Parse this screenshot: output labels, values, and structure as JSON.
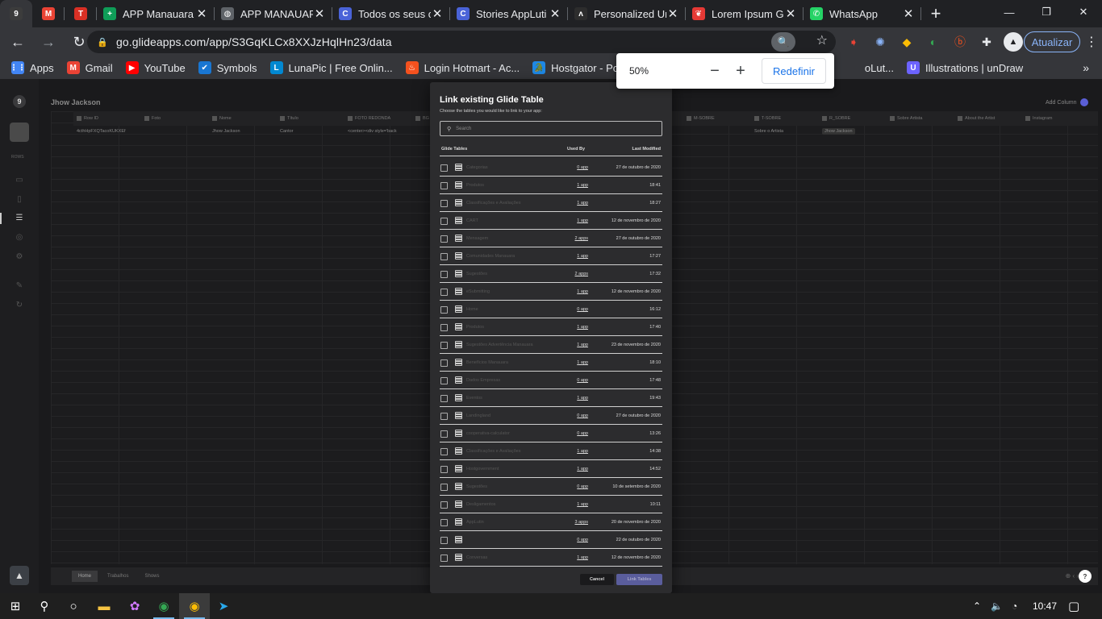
{
  "browser": {
    "tabs": [
      {
        "label": "",
        "icon": "9",
        "color": "#3c3c3c",
        "pinned": true,
        "active": true
      },
      {
        "label": "",
        "icon": "M",
        "color": "#ea4335",
        "pinned": true
      },
      {
        "label": "",
        "icon": "T",
        "color": "#d93025",
        "pinned": true
      },
      {
        "label": "APP Manauara",
        "icon": "+",
        "color": "#0f9d58"
      },
      {
        "label": "APP MANAUAR",
        "icon": "◍",
        "color": "#5f6368"
      },
      {
        "label": "Todos os seus c",
        "icon": "C",
        "color": "#4a63d8"
      },
      {
        "label": "Stories AppLuti",
        "icon": "C",
        "color": "#4a63d8"
      },
      {
        "label": "Personalized Ur",
        "icon": "ʌ",
        "color": "#2d2d2d"
      },
      {
        "label": "Lorem Ipsum G",
        "icon": "❦",
        "color": "#e53935"
      },
      {
        "label": "WhatsApp",
        "icon": "✆",
        "color": "#25d366"
      }
    ],
    "url": "go.glideapps.com/app/S3GqKLCx8XXJzHqlHn23/data",
    "update_label": "Atualizar",
    "bookmarks": [
      {
        "label": "Apps",
        "icon": "⋮⋮",
        "color": "#4285f4"
      },
      {
        "label": "Gmail",
        "icon": "M",
        "color": "#ea4335"
      },
      {
        "label": "YouTube",
        "icon": "▶",
        "color": "#ff0000"
      },
      {
        "label": "Symbols",
        "icon": "✔",
        "color": "#1976d2"
      },
      {
        "label": "LunaPic | Free Onlin...",
        "icon": "L",
        "color": "#0288d1"
      },
      {
        "label": "Login Hotmart - Ac...",
        "icon": "♨",
        "color": "#f4511e"
      },
      {
        "label": "Hostgator - Portal...",
        "icon": "🐊",
        "color": "#1e88e5"
      },
      {
        "label": "oLut...",
        "icon": "",
        "color": "#35363a"
      },
      {
        "label": "Illustrations | unDraw",
        "icon": "U",
        "color": "#6c63ff"
      }
    ]
  },
  "zoom": {
    "value": "50%",
    "minus": "−",
    "plus": "+",
    "reset": "Redefinir"
  },
  "app": {
    "left_rows_label": "ROWS",
    "sheet_title": "Jhow Jackson",
    "add_column": "Add Column",
    "columns": [
      "Row ID",
      "Foto",
      "Nome",
      "Título",
      "FOTO REDONDA",
      "BG",
      "",
      "",
      "",
      "M-SOBRE",
      "T-SOBRE",
      "R_SOBRE",
      "Sobre Artista",
      "About the Artist",
      "Instagram"
    ],
    "row": [
      "4cthHpFXQTacoKUKXEf",
      "",
      "Jhow Jackson",
      "Cantor",
      "<center><div style='back",
      "",
      "",
      "",
      "",
      "",
      "Sobre o Artista",
      "Jhow Jackson",
      "",
      "",
      ""
    ],
    "bottom_tabs": [
      "Home",
      "Trabalhos",
      "Shows"
    ],
    "help": "?"
  },
  "modal": {
    "title": "Link existing Glide Table",
    "subtitle": "Choose the tables you would like to link to your app:",
    "search_placeholder": "Search",
    "col_tables": "Glide Tables",
    "col_used": "Used By",
    "col_modified": "Last Modified",
    "rows": [
      {
        "name": "Categorias",
        "used": "0 app",
        "modified": "27 de outubro de 2020"
      },
      {
        "name": "Produtos",
        "used": "1 app",
        "modified": "18:41"
      },
      {
        "name": "Classificações e Avaliações",
        "used": "1 app",
        "modified": "18:27"
      },
      {
        "name": "CART",
        "used": "1 app",
        "modified": "12 de novembro de 2020"
      },
      {
        "name": "Mensagem",
        "used": "2 apps",
        "modified": "27 de outubro de 2020"
      },
      {
        "name": "Comunidades Manauara",
        "used": "1 app",
        "modified": "17:27"
      },
      {
        "name": "Sugestões",
        "used": "2 apps",
        "modified": "17:32"
      },
      {
        "name": "eSubmitting",
        "used": "1 app",
        "modified": "12 de novembro de 2020"
      },
      {
        "name": "Home",
        "used": "0 app",
        "modified": "16:12"
      },
      {
        "name": "Produtos",
        "used": "1 app",
        "modified": "17:40"
      },
      {
        "name": "Sugestões Advertência Manauara",
        "used": "1 app",
        "modified": "23 de novembro de 2020"
      },
      {
        "name": "Benefícios Manauara",
        "used": "1 app",
        "modified": "18:10"
      },
      {
        "name": "Dados Empresas",
        "used": "0 app",
        "modified": "17:48"
      },
      {
        "name": "Eventos",
        "used": "1 app",
        "modified": "19:43"
      },
      {
        "name": "Landingland",
        "used": "0 app",
        "modified": "27 de outubro de 2020"
      },
      {
        "name": "cooperativa-calculator",
        "used": "0 app",
        "modified": "13:26"
      },
      {
        "name": "Classificações e Avaliações",
        "used": "1 app",
        "modified": "14:38"
      },
      {
        "name": "Hostgovernment",
        "used": "1 app",
        "modified": "14:52"
      },
      {
        "name": "Sugestões",
        "used": "0 app",
        "modified": "10 de setembro de 2020"
      },
      {
        "name": "Desligamentos",
        "used": "1 app",
        "modified": "10:11"
      },
      {
        "name": "AppLutin",
        "used": "3 apps",
        "modified": "20 de novembro de 2020"
      },
      {
        "name": "",
        "used": "0 app",
        "modified": "22 de outubro de 2020"
      },
      {
        "name": "Conversas",
        "used": "1 app",
        "modified": "12 de novembro de 2020"
      }
    ],
    "cancel": "Cancel",
    "link": "Link Tables"
  },
  "taskbar": {
    "time": "10:47"
  }
}
